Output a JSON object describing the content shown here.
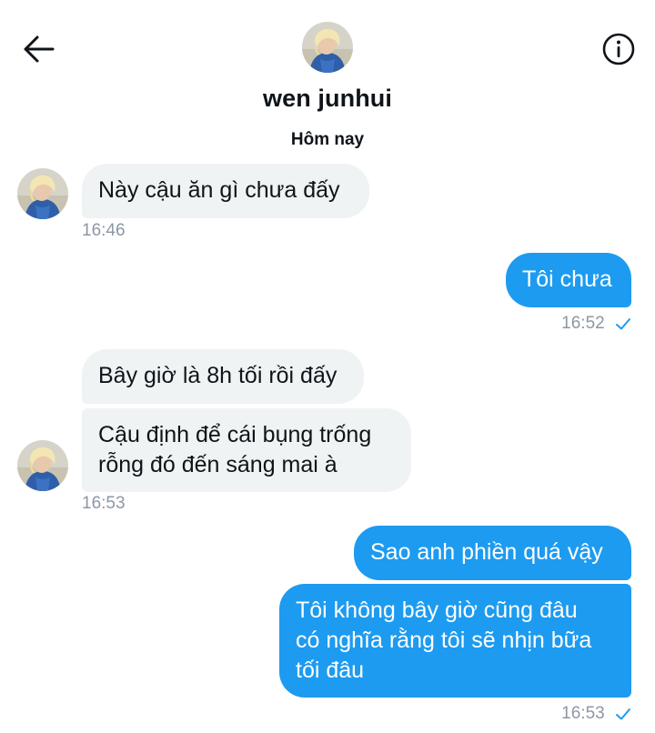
{
  "header": {
    "contact_name": "wen junhui",
    "back_icon": "arrow-left-icon",
    "info_icon": "info-icon"
  },
  "conversation": {
    "day_label": "Hôm nay",
    "groups": [
      {
        "direction": "incoming",
        "messages": [
          "Này cậu ăn gì chưa đấy"
        ],
        "time": "16:46"
      },
      {
        "direction": "outgoing",
        "messages": [
          "Tôi chưa"
        ],
        "time": "16:52",
        "status_icon": "checkmark-icon"
      },
      {
        "direction": "incoming",
        "messages": [
          "Bây giờ là 8h tối rồi đấy",
          "Cậu định để cái bụng trống\nrỗng đó đến sáng mai à"
        ],
        "time": "16:53"
      },
      {
        "direction": "outgoing",
        "messages": [
          "Sao anh phiền quá vậy",
          "Tôi không bây giờ cũng đâu\ncó nghĩa rằng tôi sẽ nhịn bữa\ntối đâu"
        ],
        "time": "16:53",
        "status_icon": "checkmark-icon"
      }
    ]
  },
  "colors": {
    "outgoing_bubble": "#1d9bf0",
    "incoming_bubble": "#eff3f4",
    "timestamp": "#8b98a5",
    "checkmark": "#1d9bf0"
  }
}
